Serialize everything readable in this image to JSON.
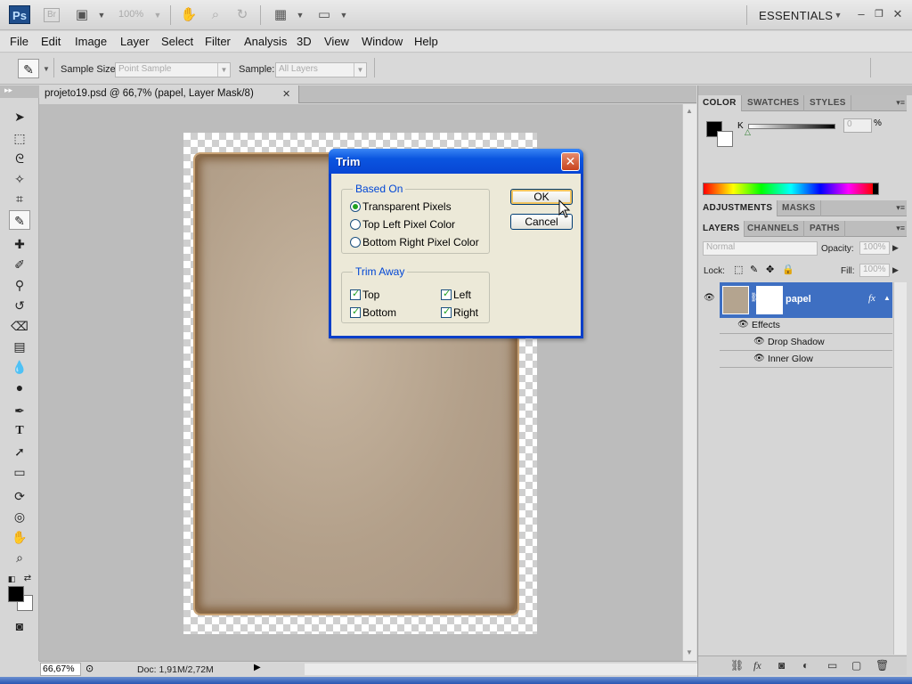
{
  "appbar": {
    "logo": "Ps",
    "bridge": "Br",
    "zoom": "100%",
    "workspace": "ESSENTIALS"
  },
  "menu": [
    "File",
    "Edit",
    "Image",
    "Layer",
    "Select",
    "Filter",
    "Analysis",
    "3D",
    "View",
    "Window",
    "Help"
  ],
  "options": {
    "sample_size_label": "Sample Size:",
    "sample_size_value": "Point Sample",
    "sample_label": "Sample:",
    "sample_value": "All Layers"
  },
  "document": {
    "tab_title": "projeto19.psd @ 66,7% (papel, Layer Mask/8)",
    "zoom": "66,67%",
    "doc_info": "Doc: 1,91M/2,72M"
  },
  "dialog": {
    "title": "Trim",
    "based_on_legend": "Based On",
    "radio_transparent": "Transparent Pixels",
    "radio_top_left": "Top Left Pixel Color",
    "radio_bottom_right": "Bottom Right Pixel Color",
    "trim_away_legend": "Trim Away",
    "check_top": "Top",
    "check_left": "Left",
    "check_bottom": "Bottom",
    "check_right": "Right",
    "ok": "OK",
    "cancel": "Cancel"
  },
  "panels": {
    "color_tabs": [
      "COLOR",
      "SWATCHES",
      "STYLES"
    ],
    "color_channel": "K",
    "color_value": "0",
    "color_unit": "%",
    "adjust_tabs": [
      "ADJUSTMENTS",
      "MASKS"
    ],
    "layer_tabs": [
      "LAYERS",
      "CHANNELS",
      "PATHS"
    ],
    "blend_mode": "Normal",
    "opacity_label": "Opacity:",
    "opacity_value": "100%",
    "lock_label": "Lock:",
    "fill_label": "Fill:",
    "fill_value": "100%",
    "layer_name": "papel",
    "fx": "fx",
    "effects_label": "Effects",
    "effect_1": "Drop Shadow",
    "effect_2": "Inner Glow"
  }
}
